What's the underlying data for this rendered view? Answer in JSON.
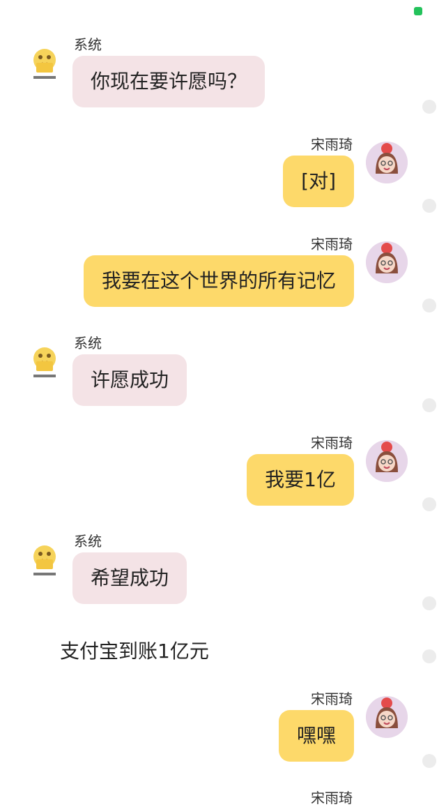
{
  "messages": [
    {
      "side": "left",
      "name": "系统",
      "text": "你现在要许愿吗？"
    },
    {
      "side": "right",
      "name": "宋雨琦",
      "text": "[对]"
    },
    {
      "side": "right",
      "name": "宋雨琦",
      "text": "我要在这个世界的所有记忆"
    },
    {
      "side": "left",
      "name": "系统",
      "text": "许愿成功"
    },
    {
      "side": "right",
      "name": "宋雨琦",
      "text": "我要1亿"
    },
    {
      "side": "left",
      "name": "系统",
      "text": "希望成功"
    },
    {
      "side": "plain",
      "text": "支付宝到账1亿元"
    },
    {
      "side": "right",
      "name": "宋雨琦",
      "text": "嘿嘿"
    },
    {
      "side": "right",
      "name": "宋雨琦",
      "text": ""
    }
  ],
  "avatars": {
    "system_icon": "cartoon-bird-avatar",
    "user_icon": "girl-avatar"
  },
  "colors": {
    "left_bubble": "#f4e3e6",
    "right_bubble": "#fdd96a",
    "status": "#23c25b"
  }
}
